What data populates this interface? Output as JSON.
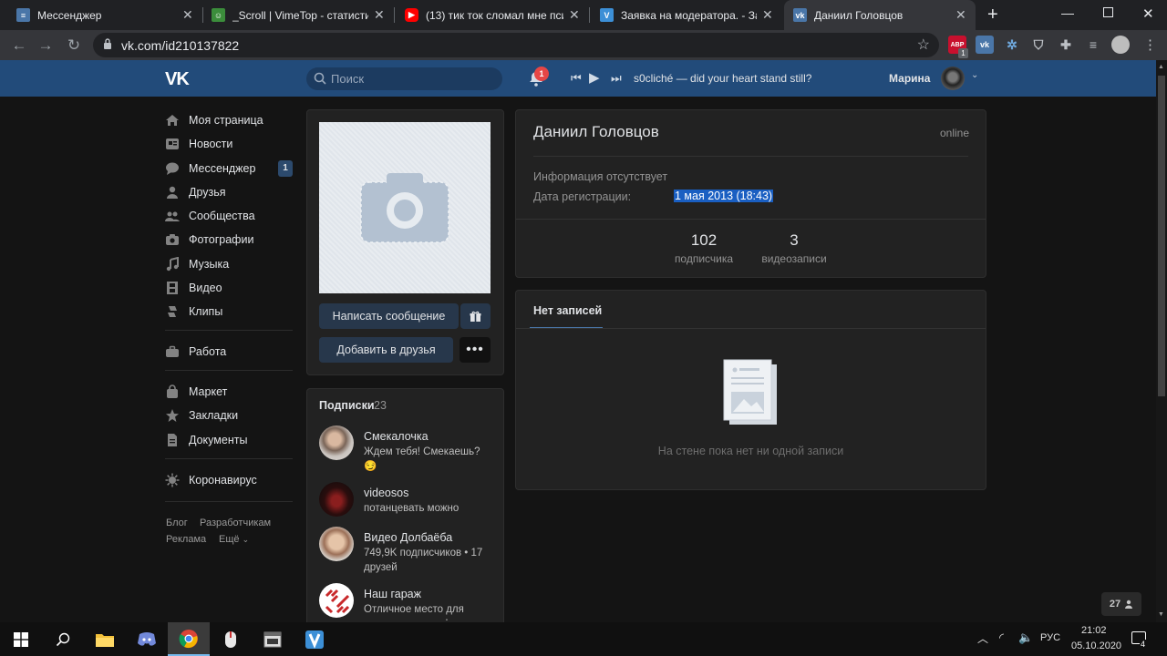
{
  "browser": {
    "tabs": [
      {
        "title": "Мессенджер",
        "icon": "vk-icon"
      },
      {
        "title": "_Scroll | VimeTop - статистика",
        "icon": "vimetop-icon"
      },
      {
        "title": "(13) тик ток сломал мне психику",
        "icon": "youtube-icon"
      },
      {
        "title": "Заявка на модератора. - Заявки",
        "icon": "vime-icon"
      },
      {
        "title": "Даниил Головцов",
        "icon": "vk-icon"
      }
    ],
    "new_tab": "+",
    "url": "vk.com/id210137822",
    "ext_badge": "1",
    "ext_abp": "ABP"
  },
  "vk_header": {
    "logo": "VK",
    "search_placeholder": "Поиск",
    "notifications_count": "1",
    "track": "s0cliché — did your heart stand still?",
    "user_name": "Марина"
  },
  "sidebar": {
    "items": [
      {
        "label": "Моя страница",
        "icon": "home-icon"
      },
      {
        "label": "Новости",
        "icon": "news-icon"
      },
      {
        "label": "Мессенджер",
        "icon": "chat-icon"
      },
      {
        "label": "Друзья",
        "icon": "user-icon"
      },
      {
        "label": "Сообщества",
        "icon": "group-icon"
      },
      {
        "label": "Фотографии",
        "icon": "camera-icon"
      },
      {
        "label": "Музыка",
        "icon": "music-icon"
      },
      {
        "label": "Видео",
        "icon": "film-icon"
      },
      {
        "label": "Клипы",
        "icon": "clips-icon"
      },
      {
        "label": "Работа",
        "icon": "briefcase-icon"
      },
      {
        "label": "Маркет",
        "icon": "bag-icon"
      },
      {
        "label": "Закладки",
        "icon": "star-icon"
      },
      {
        "label": "Документы",
        "icon": "document-icon"
      },
      {
        "label": "Коронавирус",
        "icon": "virus-icon"
      }
    ],
    "messenger_count": "1",
    "footer": {
      "blog": "Блог",
      "dev": "Разработчикам",
      "ads": "Реклама",
      "more": "Ещё"
    }
  },
  "profile": {
    "send_message": "Написать сообщение",
    "add_friend": "Добавить в друзья",
    "name": "Даниил Головцов",
    "status": "online",
    "info_missing": "Информация отсутствует",
    "reg_label": "Дата регистрации:",
    "reg_value": "1 мая 2013 (18:43)",
    "stats": [
      {
        "count": "102",
        "label": "подписчика"
      },
      {
        "count": "3",
        "label": "видеозаписи"
      }
    ]
  },
  "subscriptions": {
    "title": "Подписки",
    "count": "23",
    "items": [
      {
        "name": "Смекалочка",
        "desc": "Ждем тебя! Смекаешь? 😏"
      },
      {
        "name": "videosos",
        "desc": "потанцевать можно"
      },
      {
        "name": "Видео Долбаёба",
        "desc": "749,9K подписчиков • 17 друзей"
      },
      {
        "name": "Наш гараж",
        "desc": "Отличное место для сохранения авто!"
      }
    ]
  },
  "wall": {
    "tab": "Нет записей",
    "empty_text": "На стене пока нет ни одной записи"
  },
  "page_counter": "27",
  "taskbar": {
    "lang": "РУС",
    "time": "21:02",
    "date": "05.10.2020",
    "notif_count": "4"
  }
}
